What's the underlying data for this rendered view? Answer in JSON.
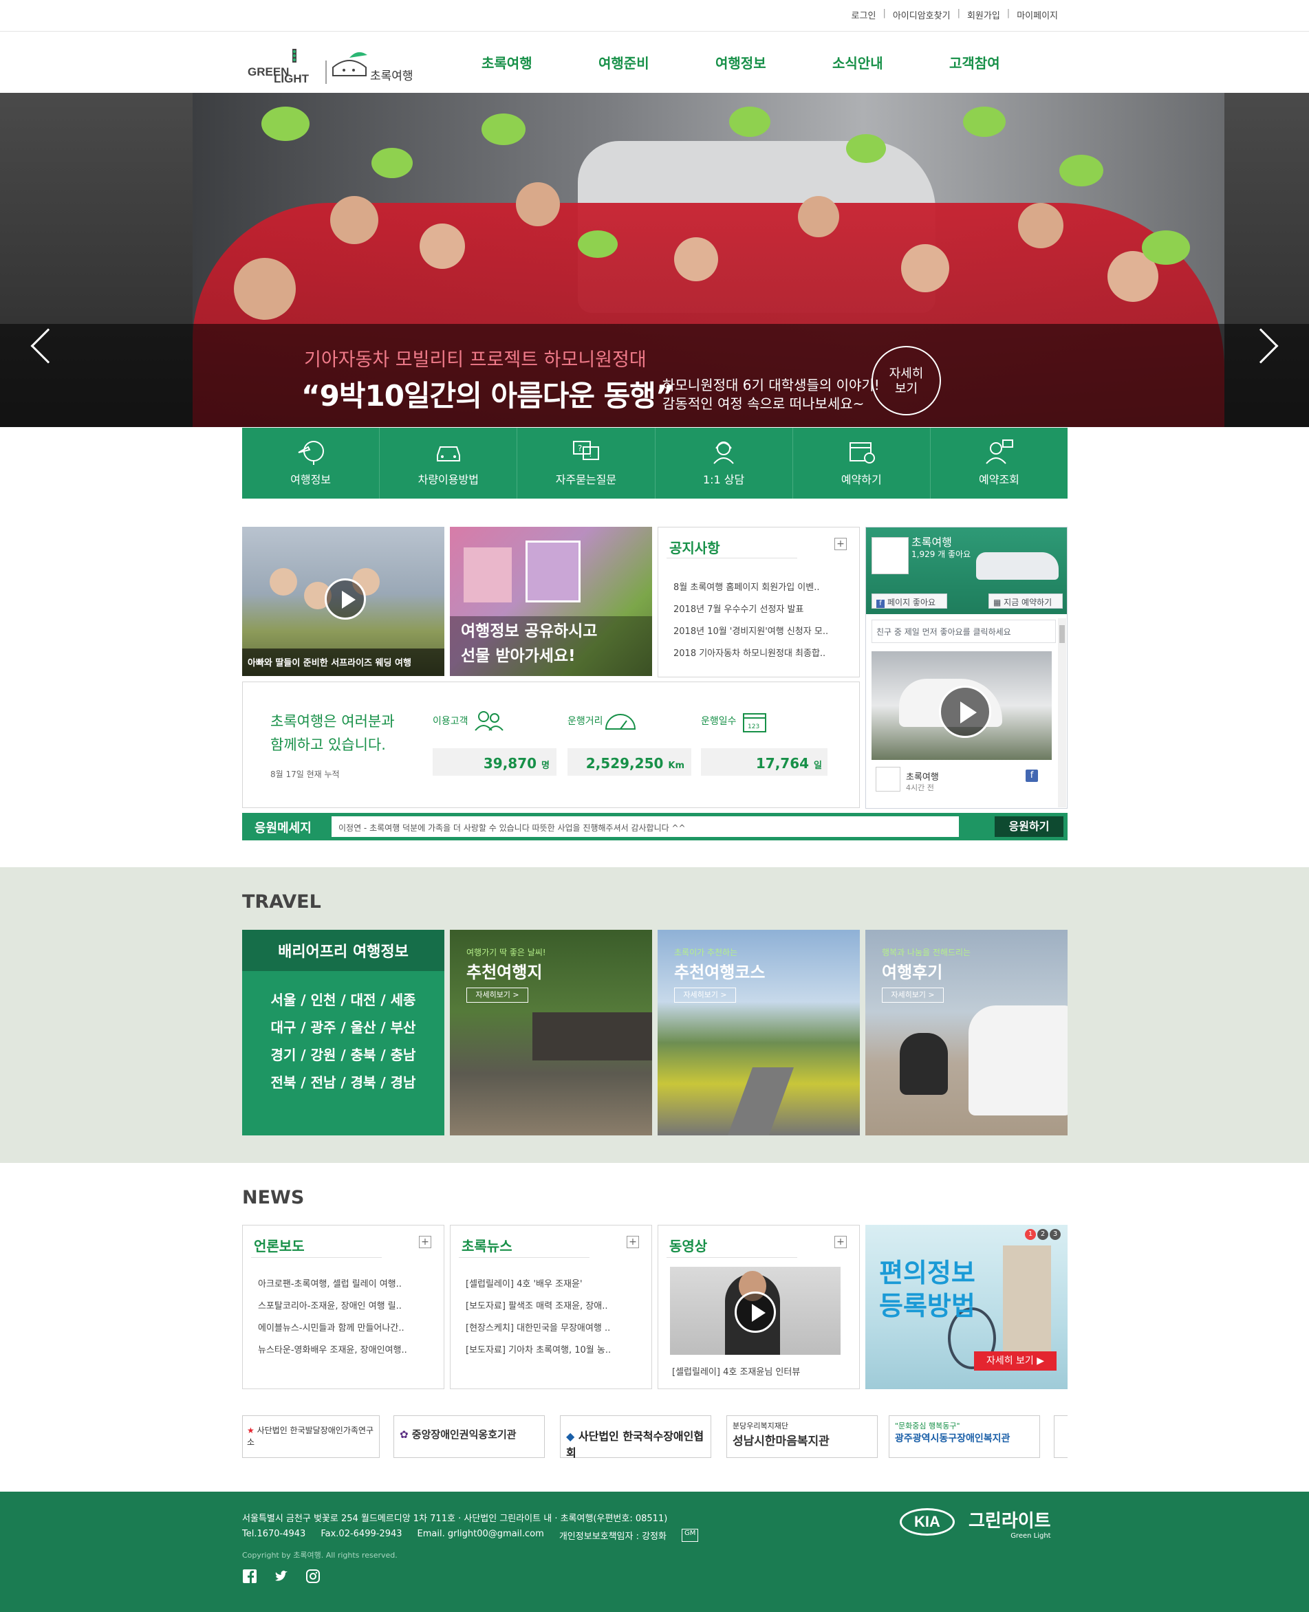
{
  "util": {
    "links": [
      "로그인",
      "아이디암호찾기",
      "회원가입",
      "마이페이지"
    ]
  },
  "logo": {
    "brand": "GREEN LIGHT",
    "sub": "초록여행"
  },
  "nav": [
    "초록여행",
    "여행준비",
    "여행정보",
    "소식안내",
    "고객참여"
  ],
  "hero": {
    "subtitle": "기아자동차 모빌리티 프로젝트 하모니원정대",
    "title": "“9박10일간의 아름다운 동행”",
    "desc_line1": "하모니원정대 6기 대학생들의 이야기!",
    "desc_line2": "감동적인 여정 속으로 떠나보세요~",
    "more": "자세히 보기",
    "more_line1": "자세히",
    "more_line2": "보기"
  },
  "quick": [
    {
      "label": "여행정보",
      "icon": "travel-info-icon"
    },
    {
      "label": "차량이용방법",
      "icon": "car-icon"
    },
    {
      "label": "자주묻는질문",
      "icon": "faq-icon"
    },
    {
      "label": "1:1 상담",
      "icon": "consult-icon"
    },
    {
      "label": "예약하기",
      "icon": "calendar-icon"
    },
    {
      "label": "예약조회",
      "icon": "my-reservation-icon"
    }
  ],
  "video1": {
    "caption": "아빠와 딸들이 준비한 서프라이즈 웨딩 여행"
  },
  "event": {
    "line1": "여행정보 공유하시고",
    "line2": "선물 받아가세요!"
  },
  "notice": {
    "title": "공지사항",
    "items": [
      "8월 초록여행 홈페이지 회원가입 이벤..",
      "2018년 7월 우수수기 선정자 발표",
      "2018년 10월 '경비지원'여행 신청자 모..",
      "2018 기아자동차 하모니원정대 최종합.."
    ]
  },
  "facebook": {
    "page": "초록여행",
    "likes": "1,929 개 좋아요",
    "like_btn": "페이지 좋아요",
    "book_btn": "지금 예약하기",
    "friend_text": "친구 중 제일 먼저 좋아요를 클릭하세요",
    "post_name": "초록여행",
    "post_time": "4시간 전"
  },
  "stats": {
    "headline1": "초록여행은 여러분과",
    "headline2": "함께하고 있습니다.",
    "asof": "8월 17일 현재 누적",
    "items": [
      {
        "label": "이용고객",
        "value": "39,870",
        "unit": "명",
        "icon": "people-icon"
      },
      {
        "label": "운행거리",
        "value": "2,529,250",
        "unit": "Km",
        "icon": "gauge-icon"
      },
      {
        "label": "운행일수",
        "value": "17,764",
        "unit": "일",
        "icon": "calendar-days-icon"
      }
    ]
  },
  "cheer": {
    "label": "응원메세지",
    "message": "이정연 - 초록여행 덕분에 가족을 더 사랑할 수 있습니다 따뜻한 사업을 진행해주셔서 감사합니다 ^^",
    "button": "응원하기"
  },
  "travel": {
    "title": "TRAVEL",
    "barrier_title": "배리어프리 여행정보",
    "regions": [
      "서울 / 인천 / 대전 / 세종",
      "대구 / 광주 / 울산 / 부산",
      "경기 / 강원 / 충북 / 충남",
      "전북 / 전남 / 경북 / 경남"
    ],
    "cards": [
      {
        "tag": "여행가기 딱 좋은 날씨!",
        "title": "추천여행지",
        "btn": "자세히보기  >"
      },
      {
        "tag": "초록이가 추천하는",
        "title": "추천여행코스",
        "btn": "자세히보기  >"
      },
      {
        "tag": "행복과 나눔을 전해드리는",
        "title": "여행후기",
        "btn": "자세히보기  >"
      }
    ]
  },
  "news": {
    "title": "NEWS",
    "press": {
      "title": "언론보도",
      "items": [
        "아크로팬-초록여행, 셀럽 릴레이 여행..",
        "스포탈코리아-조재윤, 장애인 여행 릴..",
        "에이블뉴스-시민들과 함께 만들어나간..",
        "뉴스타운-영화배우 조재윤, 장애인여행.."
      ]
    },
    "green": {
      "title": "초록뉴스",
      "items": [
        "[셀럽릴레이] 4호 '배우 조재윤'",
        "[보도자료] 팔색조 매력 조재윤, 장애..",
        "[현장스케치] 대한민국을 무장애여행 ..",
        "[보도자료] 기아차 초록여행, 10월 농.."
      ]
    },
    "video": {
      "title": "동영상",
      "caption": "[셀럽릴레이] 4호 조재윤님 인터뷰"
    },
    "banner": {
      "line1": "편의정보",
      "line2": "등록방법",
      "btn": "자세히 보기 ▶",
      "pages": [
        "1",
        "2",
        "3"
      ]
    }
  },
  "partners": [
    {
      "name": "사단법인 한국발달장애인가족연구소"
    },
    {
      "name": "중앙장애인권익옹호기관"
    },
    {
      "name": "사단법인 한국척수장애인협회"
    },
    {
      "top": "분당우리복지재단",
      "name": "성남시한마음복지관"
    },
    {
      "top": "\"문화중심 행복동구\"",
      "name": "광주광역시동구장애인복지관"
    }
  ],
  "footer": {
    "address": "서울특별시 금천구 벚꽃로 254 월드메르디앙 1차 711호 · 사단법인 그린라이트 내 · 초록여행(우편번호: 08511)",
    "tel": "Tel.1670-4943",
    "fax": "Fax.02-6499-2943",
    "email": "Email. grlight00@gmail.com",
    "privacy": "개인정보보호책임자 : 강정화",
    "gm": "GM",
    "copyright": "Copyright by 초록여행. All rights reserved.",
    "kia": "KIA",
    "gl": "그린라이트",
    "gl_en": "Green Light"
  },
  "colors": {
    "brand_green": "#1e9663",
    "nav_green": "#179048",
    "footer_green": "#1b7c52",
    "travel_bg": "#e1e7de"
  }
}
